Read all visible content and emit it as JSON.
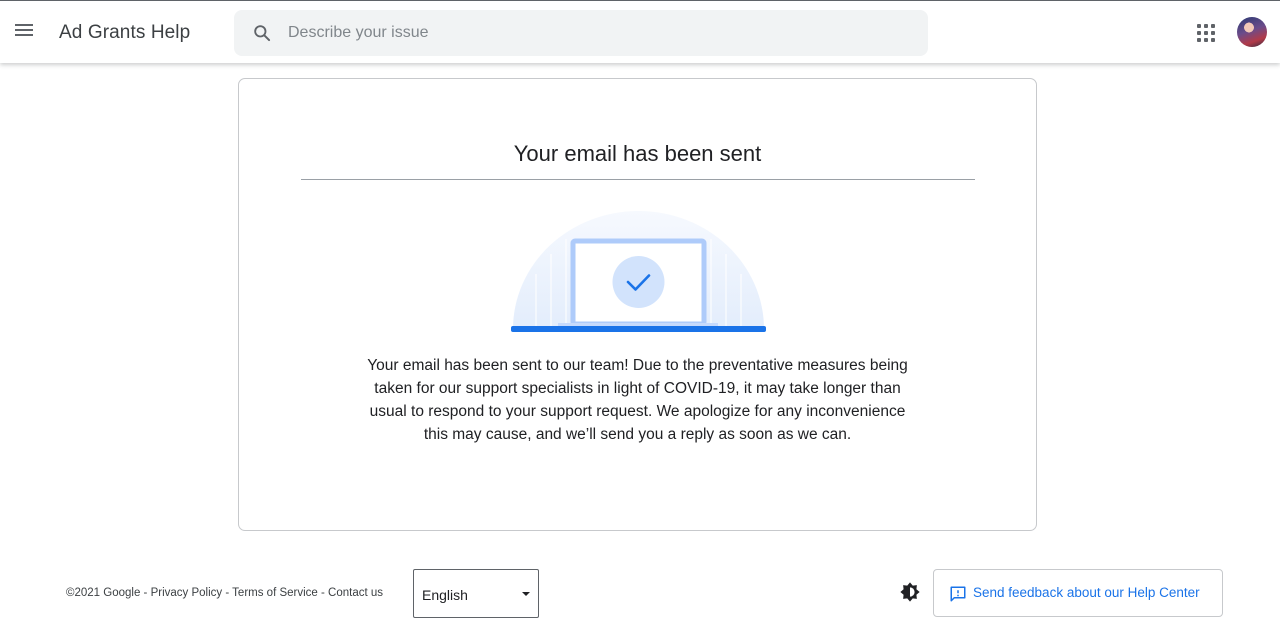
{
  "header": {
    "app_title": "Ad Grants Help",
    "menu_icon": "hamburger-menu-icon",
    "apps_icon": "google-apps-grid-icon",
    "avatar": "account-avatar"
  },
  "search": {
    "placeholder": "Describe your issue",
    "value": "",
    "icon": "search-icon"
  },
  "confirmation": {
    "title": "Your email has been sent",
    "illustration": "laptop-checkmark-illustration",
    "message": "Your email has been sent to our team! Due to the preventative measures being taken for our support specialists in light of COVID-19, it may take longer than usual to respond to your support request. We apologize for any inconvenience this may cause, and we’ll send you a reply as soon as we can."
  },
  "footer": {
    "copyright": "©2021 Google",
    "separator": " - ",
    "links": [
      "Privacy Policy",
      "Terms of Service",
      "Contact us"
    ],
    "language": {
      "selected": "English"
    },
    "theme_icon": "dark-mode-toggle-icon",
    "feedback": {
      "label": "Send feedback about our Help Center",
      "icon": "feedback-icon"
    }
  },
  "colors": {
    "accent": "#1a73e8",
    "illustration_blue": "#aecbfa",
    "check_circle": "#d2e3fc",
    "search_bg": "#f1f3f4"
  }
}
